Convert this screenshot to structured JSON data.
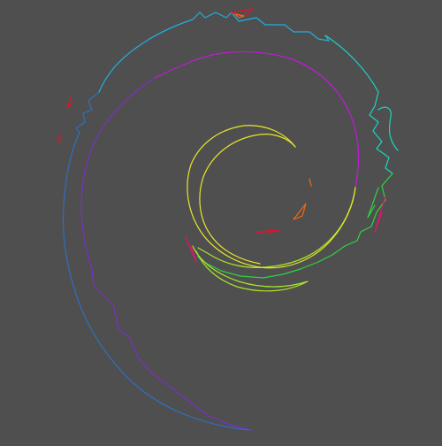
{
  "background": "#4f4f4f",
  "strokes": {
    "outer-swirl-blue": "#2f6fc0",
    "outer-swirl-cyan": "#1fb0e0",
    "outer-swirl-teal": "#19d6c0",
    "mid-swirl-purple": "#7a2fc8",
    "mid-swirl-magenta": "#c21ad9",
    "inner-swirl-yellow": "#e6e62a",
    "inner-swirl-lime": "#a8e62a",
    "inner-swirl-green": "#2ad640",
    "accent-red": "#e0142a",
    "accent-orange": "#f06a14",
    "accent-pink": "#e0146a"
  }
}
